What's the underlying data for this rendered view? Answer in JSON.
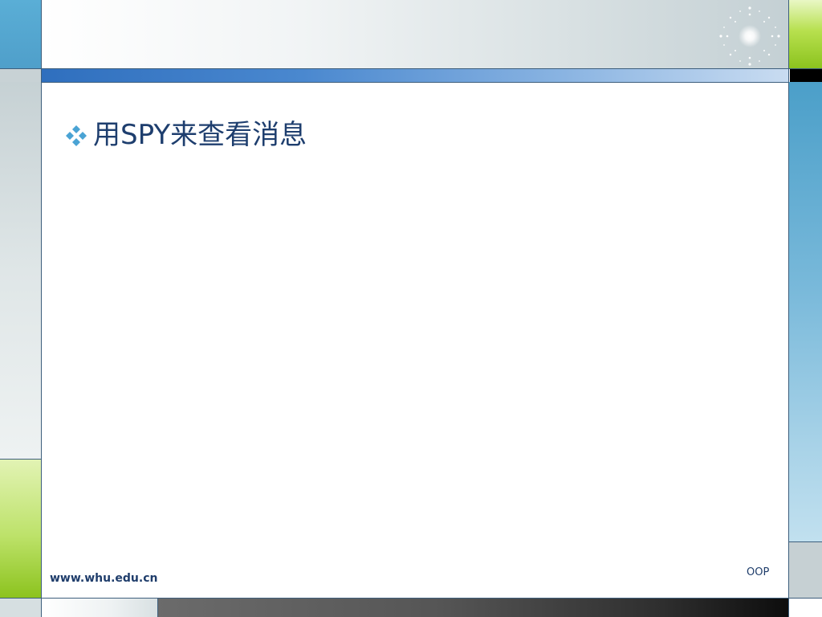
{
  "slide": {
    "bullet_text": "用SPY来查看消息",
    "footer_url": "www.whu.edu.cn",
    "footer_code": "OOP"
  },
  "icons": {
    "bullet": "four-diamond-bullet-icon",
    "logo": "sparkle-star-icon"
  },
  "colors": {
    "text": "#1e3e6e",
    "accent_blue": "#2f6fbe",
    "accent_green": "#8cc31e",
    "bullet": "#4aa3d4"
  }
}
